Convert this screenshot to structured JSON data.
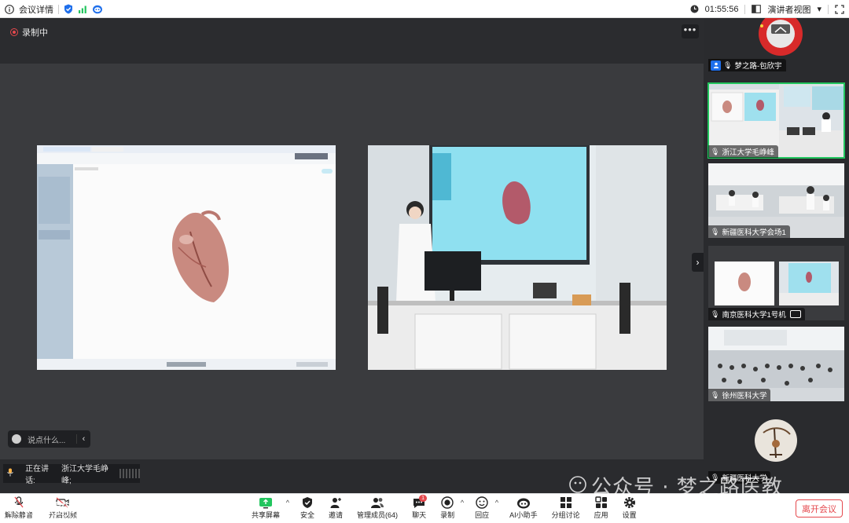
{
  "topbar": {
    "meeting_details": "会议详情",
    "timer": "01:55:56",
    "view_mode": "演讲者视图"
  },
  "stage": {
    "recording_label": "录制中",
    "more_label": "•••",
    "chat_placeholder": "说点什么...",
    "speaking_label": "正在讲话:",
    "speaking_name": "浙江大学毛峥峰;"
  },
  "participants": [
    {
      "name": "梦之路-包欣宇"
    },
    {
      "name": "浙江大学毛峥峰"
    },
    {
      "name": "新疆医科大学会场1"
    },
    {
      "name": "南京医科大学1号机"
    },
    {
      "name": "徐州医科大学"
    },
    {
      "name": "新疆医科大学"
    }
  ],
  "toolbar": {
    "left": [
      {
        "label": "解除静音"
      },
      {
        "label": "开启视频"
      }
    ],
    "center": [
      {
        "label": "共享屏幕"
      },
      {
        "label": "安全"
      },
      {
        "label": "邀请"
      },
      {
        "label": "管理成员(64)"
      },
      {
        "label": "聊天",
        "badge": "1"
      },
      {
        "label": "录制"
      },
      {
        "label": "回应"
      },
      {
        "label": "AI小助手"
      },
      {
        "label": "分组讨论"
      },
      {
        "label": "应用"
      },
      {
        "label": "设置"
      }
    ],
    "leave": "离开会议"
  },
  "watermark": {
    "official": "公众号 · 梦之路医教",
    "brand": "K 大歌跨境"
  },
  "colors": {
    "accent": "#1f6feb",
    "danger": "#e5484d",
    "active": "#22c55e"
  }
}
